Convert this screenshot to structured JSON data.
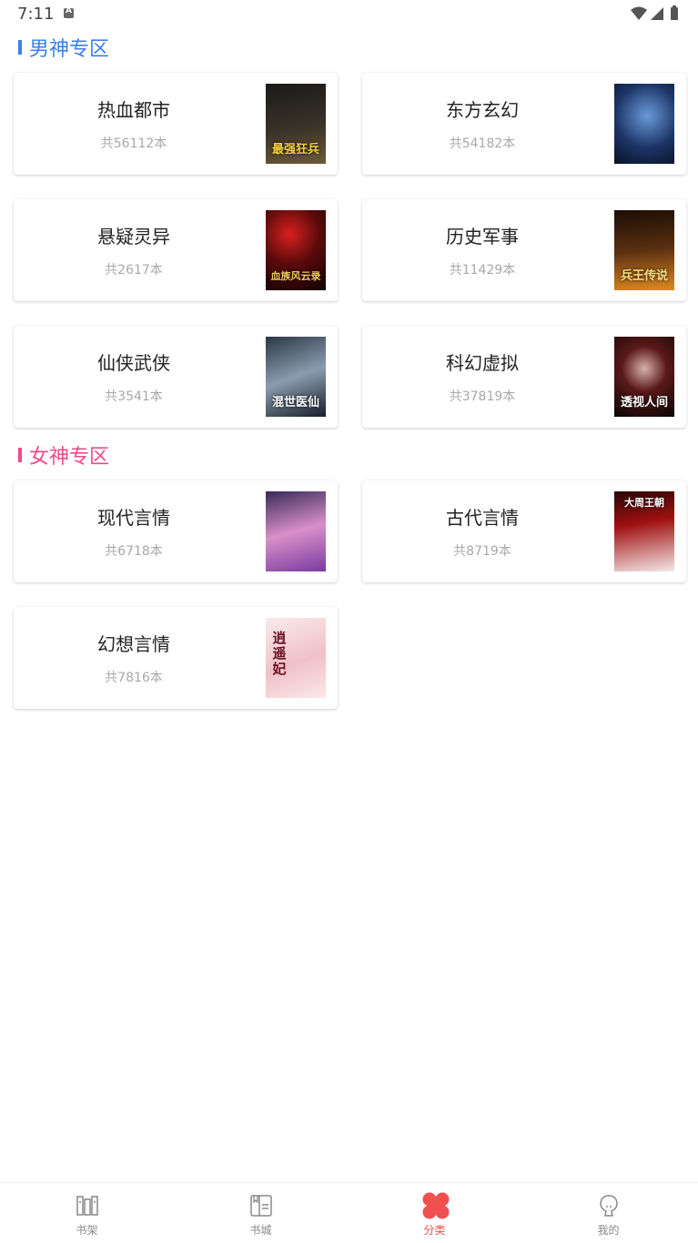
{
  "status_bar": {
    "time": "7:11"
  },
  "sections": [
    {
      "title": "男神专区",
      "accent": "#3d7fe6",
      "cards": [
        {
          "name": "热血都市",
          "count": "共56112本",
          "cover_text": "最强狂兵",
          "cover_colors": [
            "#1a1a1a",
            "#6b5a3a"
          ]
        },
        {
          "name": "东方玄幻",
          "count": "共54182本",
          "cover_text": "",
          "cover_colors": [
            "#0c1a3a",
            "#4a78b8"
          ]
        },
        {
          "name": "悬疑灵异",
          "count": "共2617本",
          "cover_text": "血族风云录",
          "cover_colors": [
            "#120404",
            "#9a1414"
          ]
        },
        {
          "name": "历史军事",
          "count": "共11429本",
          "cover_text": "兵王传说",
          "cover_colors": [
            "#1a0e06",
            "#c8741c"
          ]
        },
        {
          "name": "仙侠武侠",
          "count": "共3541本",
          "cover_text": "混世医仙",
          "cover_colors": [
            "#18202a",
            "#7a8ca0"
          ]
        },
        {
          "name": "科幻虚拟",
          "count": "共37819本",
          "cover_text": "透视人间",
          "cover_colors": [
            "#0a0606",
            "#6a1a1a"
          ]
        }
      ]
    },
    {
      "title": "女神专区",
      "accent": "#ee4a8a",
      "cards": [
        {
          "name": "现代言情",
          "count": "共6718本",
          "cover_text": "",
          "cover_colors": [
            "#3a2a5a",
            "#c87ac8"
          ]
        },
        {
          "name": "古代言情",
          "count": "共8719本",
          "cover_text": "大周王朝",
          "cover_colors": [
            "#2a0606",
            "#d82424"
          ]
        },
        {
          "name": "幻想言情",
          "count": "共7816本",
          "cover_text": "逍遥妃",
          "cover_colors": [
            "#f4e0e0",
            "#e8a8b0"
          ]
        }
      ]
    }
  ],
  "nav": {
    "items": [
      {
        "label": "书架",
        "icon": "bookshelf-icon"
      },
      {
        "label": "书城",
        "icon": "book-icon"
      },
      {
        "label": "分类",
        "icon": "category-icon",
        "active": true
      },
      {
        "label": "我的",
        "icon": "profile-icon"
      }
    ],
    "active_color": "#f0504f"
  }
}
